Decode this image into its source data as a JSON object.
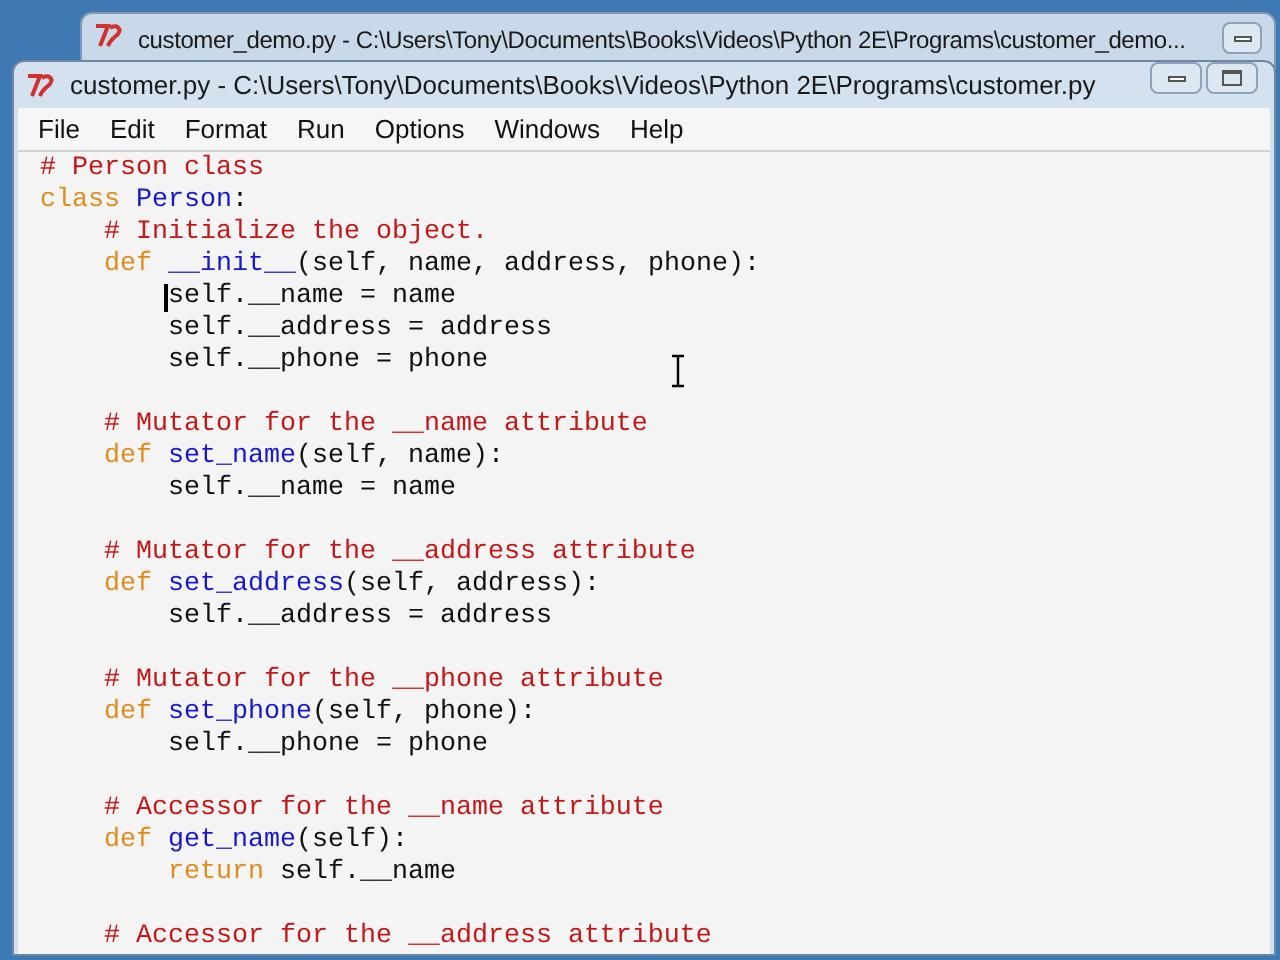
{
  "background_window": {
    "title": "customer_demo.py - C:\\Users\\Tony\\Documents\\Books\\Videos\\Python 2E\\Programs\\customer_demo..."
  },
  "window": {
    "title": "customer.py - C:\\Users\\Tony\\Documents\\Books\\Videos\\Python 2E\\Programs\\customer.py"
  },
  "menu": [
    "File",
    "Edit",
    "Format",
    "Run",
    "Options",
    "Windows",
    "Help"
  ],
  "editor": {
    "lines": [
      {
        "kind": "code",
        "tokens": [
          {
            "kind": "comment",
            "text": "# Person class"
          }
        ]
      },
      {
        "kind": "code",
        "tokens": [
          {
            "kind": "keyword",
            "text": "class "
          },
          {
            "kind": "name",
            "text": "Person"
          },
          {
            "kind": "text",
            "text": ":"
          }
        ]
      },
      {
        "kind": "code",
        "tokens": [
          {
            "kind": "comment",
            "text": "    # Initialize the object."
          }
        ]
      },
      {
        "kind": "code",
        "tokens": [
          {
            "kind": "keyword",
            "text": "    def "
          },
          {
            "kind": "name",
            "text": "__init__"
          },
          {
            "kind": "text",
            "text": "(self, name, address, phone):"
          }
        ]
      },
      {
        "kind": "code",
        "caret": true,
        "tokens": [
          {
            "kind": "text",
            "text": "        self.__name = name"
          }
        ]
      },
      {
        "kind": "code",
        "tokens": [
          {
            "kind": "text",
            "text": "        self.__address = address"
          }
        ]
      },
      {
        "kind": "code",
        "tokens": [
          {
            "kind": "text",
            "text": "        self.__phone = phone"
          }
        ]
      },
      {
        "kind": "blank"
      },
      {
        "kind": "code",
        "tokens": [
          {
            "kind": "comment",
            "text": "    # Mutator for the __name attribute"
          }
        ]
      },
      {
        "kind": "code",
        "tokens": [
          {
            "kind": "keyword",
            "text": "    def "
          },
          {
            "kind": "name",
            "text": "set_name"
          },
          {
            "kind": "text",
            "text": "(self, name):"
          }
        ]
      },
      {
        "kind": "code",
        "tokens": [
          {
            "kind": "text",
            "text": "        self.__name = name"
          }
        ]
      },
      {
        "kind": "blank"
      },
      {
        "kind": "code",
        "tokens": [
          {
            "kind": "comment",
            "text": "    # Mutator for the __address attribute"
          }
        ]
      },
      {
        "kind": "code",
        "tokens": [
          {
            "kind": "keyword",
            "text": "    def "
          },
          {
            "kind": "name",
            "text": "set_address"
          },
          {
            "kind": "text",
            "text": "(self, address):"
          }
        ]
      },
      {
        "kind": "code",
        "tokens": [
          {
            "kind": "text",
            "text": "        self.__address = address"
          }
        ]
      },
      {
        "kind": "blank"
      },
      {
        "kind": "code",
        "tokens": [
          {
            "kind": "comment",
            "text": "    # Mutator for the __phone attribute"
          }
        ]
      },
      {
        "kind": "code",
        "tokens": [
          {
            "kind": "keyword",
            "text": "    def "
          },
          {
            "kind": "name",
            "text": "set_phone"
          },
          {
            "kind": "text",
            "text": "(self, phone):"
          }
        ]
      },
      {
        "kind": "code",
        "tokens": [
          {
            "kind": "text",
            "text": "        self.__phone = phone"
          }
        ]
      },
      {
        "kind": "blank"
      },
      {
        "kind": "code",
        "tokens": [
          {
            "kind": "comment",
            "text": "    # Accessor for the __name attribute"
          }
        ]
      },
      {
        "kind": "code",
        "tokens": [
          {
            "kind": "keyword",
            "text": "    def "
          },
          {
            "kind": "name",
            "text": "get_name"
          },
          {
            "kind": "text",
            "text": "(self):"
          }
        ]
      },
      {
        "kind": "code",
        "tokens": [
          {
            "kind": "keyword",
            "text": "        return"
          },
          {
            "kind": "text",
            "text": " self.__name"
          }
        ]
      },
      {
        "kind": "blank"
      },
      {
        "kind": "code",
        "tokens": [
          {
            "kind": "comment",
            "text": "    # Accessor for the __address attribute"
          }
        ]
      }
    ]
  }
}
